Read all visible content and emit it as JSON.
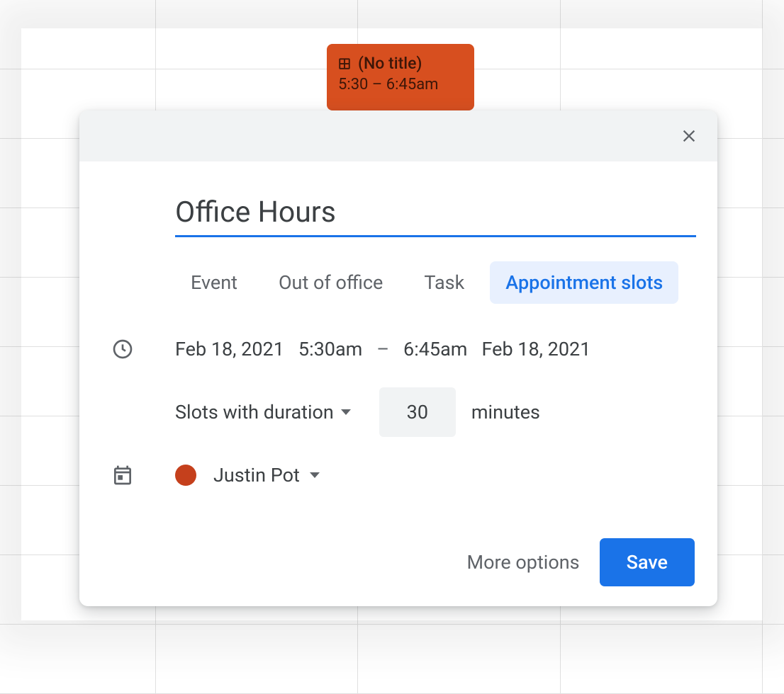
{
  "calendar_event": {
    "title": "(No title)",
    "time_range": "5:30 – 6:45am"
  },
  "dialog": {
    "title_value": "Office Hours",
    "tabs": {
      "event": "Event",
      "out_of_office": "Out of office",
      "task": "Task",
      "appointment_slots": "Appointment slots"
    },
    "date": {
      "start_date": "Feb 18, 2021",
      "start_time": "5:30am",
      "separator": "–",
      "end_time": "6:45am",
      "end_date": "Feb 18, 2021"
    },
    "slots": {
      "label": "Slots with duration",
      "duration_value": "30",
      "unit": "minutes"
    },
    "calendar": {
      "color": "#c5401c",
      "owner": "Justin Pot"
    },
    "footer": {
      "more_options": "More options",
      "save": "Save"
    }
  }
}
